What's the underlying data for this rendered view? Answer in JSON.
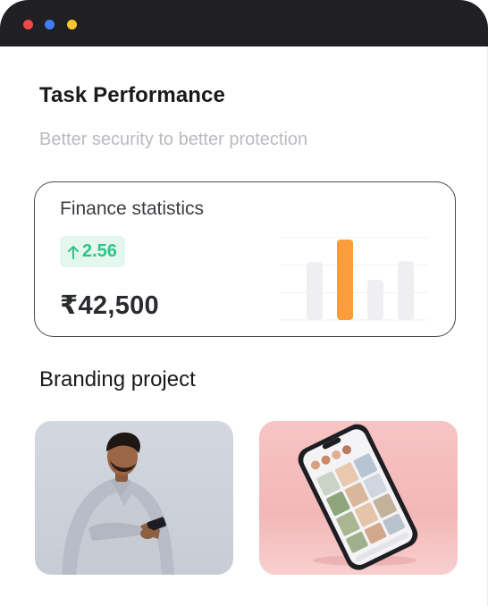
{
  "window": {
    "controls": [
      "close",
      "minimize",
      "maximize"
    ],
    "colors": {
      "close": "#f0474b",
      "minimize": "#3f7ef6",
      "maximize": "#f7c531"
    }
  },
  "header": {
    "title": "Task Performance",
    "subtitle": "Better security to better protection"
  },
  "finance_card": {
    "title": "Finance statistics",
    "change": "2.56",
    "change_icon": "arrow-up-icon",
    "amount": "₹42,500",
    "accent": "#fa9d3a",
    "chart_values": [
      0.72,
      1.0,
      0.5,
      0.73
    ],
    "highlight_index": 1
  },
  "branding": {
    "title": "Branding project",
    "images": [
      {
        "name": "man-with-phone-photo"
      },
      {
        "name": "phone-mockup-photo"
      }
    ]
  }
}
